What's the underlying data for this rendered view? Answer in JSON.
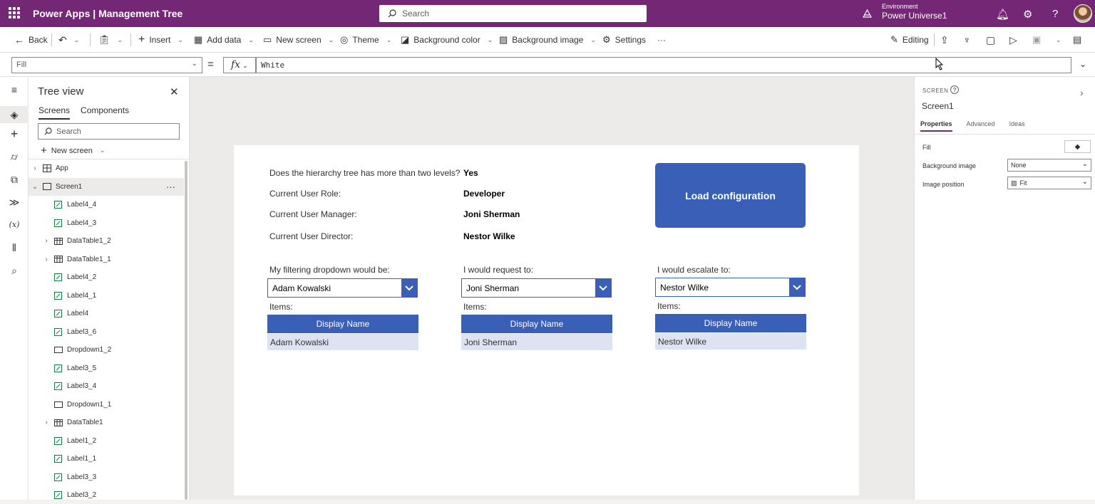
{
  "app": {
    "title": "Power Apps  |  Management Tree",
    "search_placeholder": "Search",
    "env_label": "Environment",
    "env_name": "Power Universe1"
  },
  "toolbar": {
    "back": "Back",
    "insert": "Insert",
    "add_data": "Add data",
    "new_screen": "New screen",
    "theme": "Theme",
    "background_color": "Background color",
    "background_image": "Background image",
    "settings": "Settings",
    "more": "···",
    "editing": "Editing"
  },
  "formula": {
    "property": "Fill",
    "fx": "fx",
    "value": "White"
  },
  "tree": {
    "title": "Tree view",
    "tabs": [
      "Screens",
      "Components"
    ],
    "search_placeholder": "Search",
    "new_screen": "New screen",
    "items": [
      {
        "label": "App",
        "type": "app",
        "expander": "›",
        "indent": 0
      },
      {
        "label": "Screen1",
        "type": "screen",
        "expander": "⌄",
        "indent": 0,
        "selected": true
      },
      {
        "label": "Label4_4",
        "type": "label",
        "indent": 1
      },
      {
        "label": "Label4_3",
        "type": "label",
        "indent": 1
      },
      {
        "label": "DataTable1_2",
        "type": "table",
        "expander": "›",
        "indent": 1
      },
      {
        "label": "DataTable1_1",
        "type": "table",
        "expander": "›",
        "indent": 1
      },
      {
        "label": "Label4_2",
        "type": "label",
        "indent": 1
      },
      {
        "label": "Label4_1",
        "type": "label",
        "indent": 1
      },
      {
        "label": "Label4",
        "type": "label",
        "indent": 1
      },
      {
        "label": "Label3_6",
        "type": "label",
        "indent": 1
      },
      {
        "label": "Dropdown1_2",
        "type": "dropdown",
        "indent": 1
      },
      {
        "label": "Label3_5",
        "type": "label",
        "indent": 1
      },
      {
        "label": "Label3_4",
        "type": "label",
        "indent": 1
      },
      {
        "label": "Dropdown1_1",
        "type": "dropdown",
        "indent": 1
      },
      {
        "label": "DataTable1",
        "type": "table",
        "expander": "›",
        "indent": 1
      },
      {
        "label": "Label1_2",
        "type": "label",
        "indent": 1
      },
      {
        "label": "Label1_1",
        "type": "label",
        "indent": 1
      },
      {
        "label": "Label3_3",
        "type": "label",
        "indent": 1
      },
      {
        "label": "Label3_2",
        "type": "label",
        "indent": 1
      }
    ]
  },
  "canvas": {
    "q1_label": "Does the hierarchy tree has more than two levels?",
    "q1_value": "Yes",
    "role_label": "Current User Role:",
    "role_value": "Developer",
    "manager_label": "Current User Manager:",
    "manager_value": "Joni Sherman",
    "director_label": "Current User Director:",
    "director_value": "Nestor Wilke",
    "load_button": "Load configuration",
    "columns": [
      {
        "heading": "My filtering dropdown would be:",
        "dropdown": "Adam Kowalski",
        "items_label": "Items:",
        "table_header": "Display Name",
        "row": "Adam Kowalski"
      },
      {
        "heading": "I would request to:",
        "dropdown": "Joni Sherman",
        "items_label": "Items:",
        "table_header": "Display Name",
        "row": "Joni Sherman"
      },
      {
        "heading": "I would escalate to:",
        "dropdown": "Nestor Wilke",
        "items_label": "Items:",
        "table_header": "Display Name",
        "row": "Nestor Wilke"
      }
    ]
  },
  "properties": {
    "kind": "SCREEN",
    "name": "Screen1",
    "tabs": [
      "Properties",
      "Advanced",
      "Ideas"
    ],
    "fill_label": "Fill",
    "bg_image_label": "Background image",
    "bg_image_value": "None",
    "image_position_label": "Image position",
    "image_position_value": "Fit"
  },
  "colors": {
    "brand": "#742774",
    "accent": "#3a5fb6"
  }
}
